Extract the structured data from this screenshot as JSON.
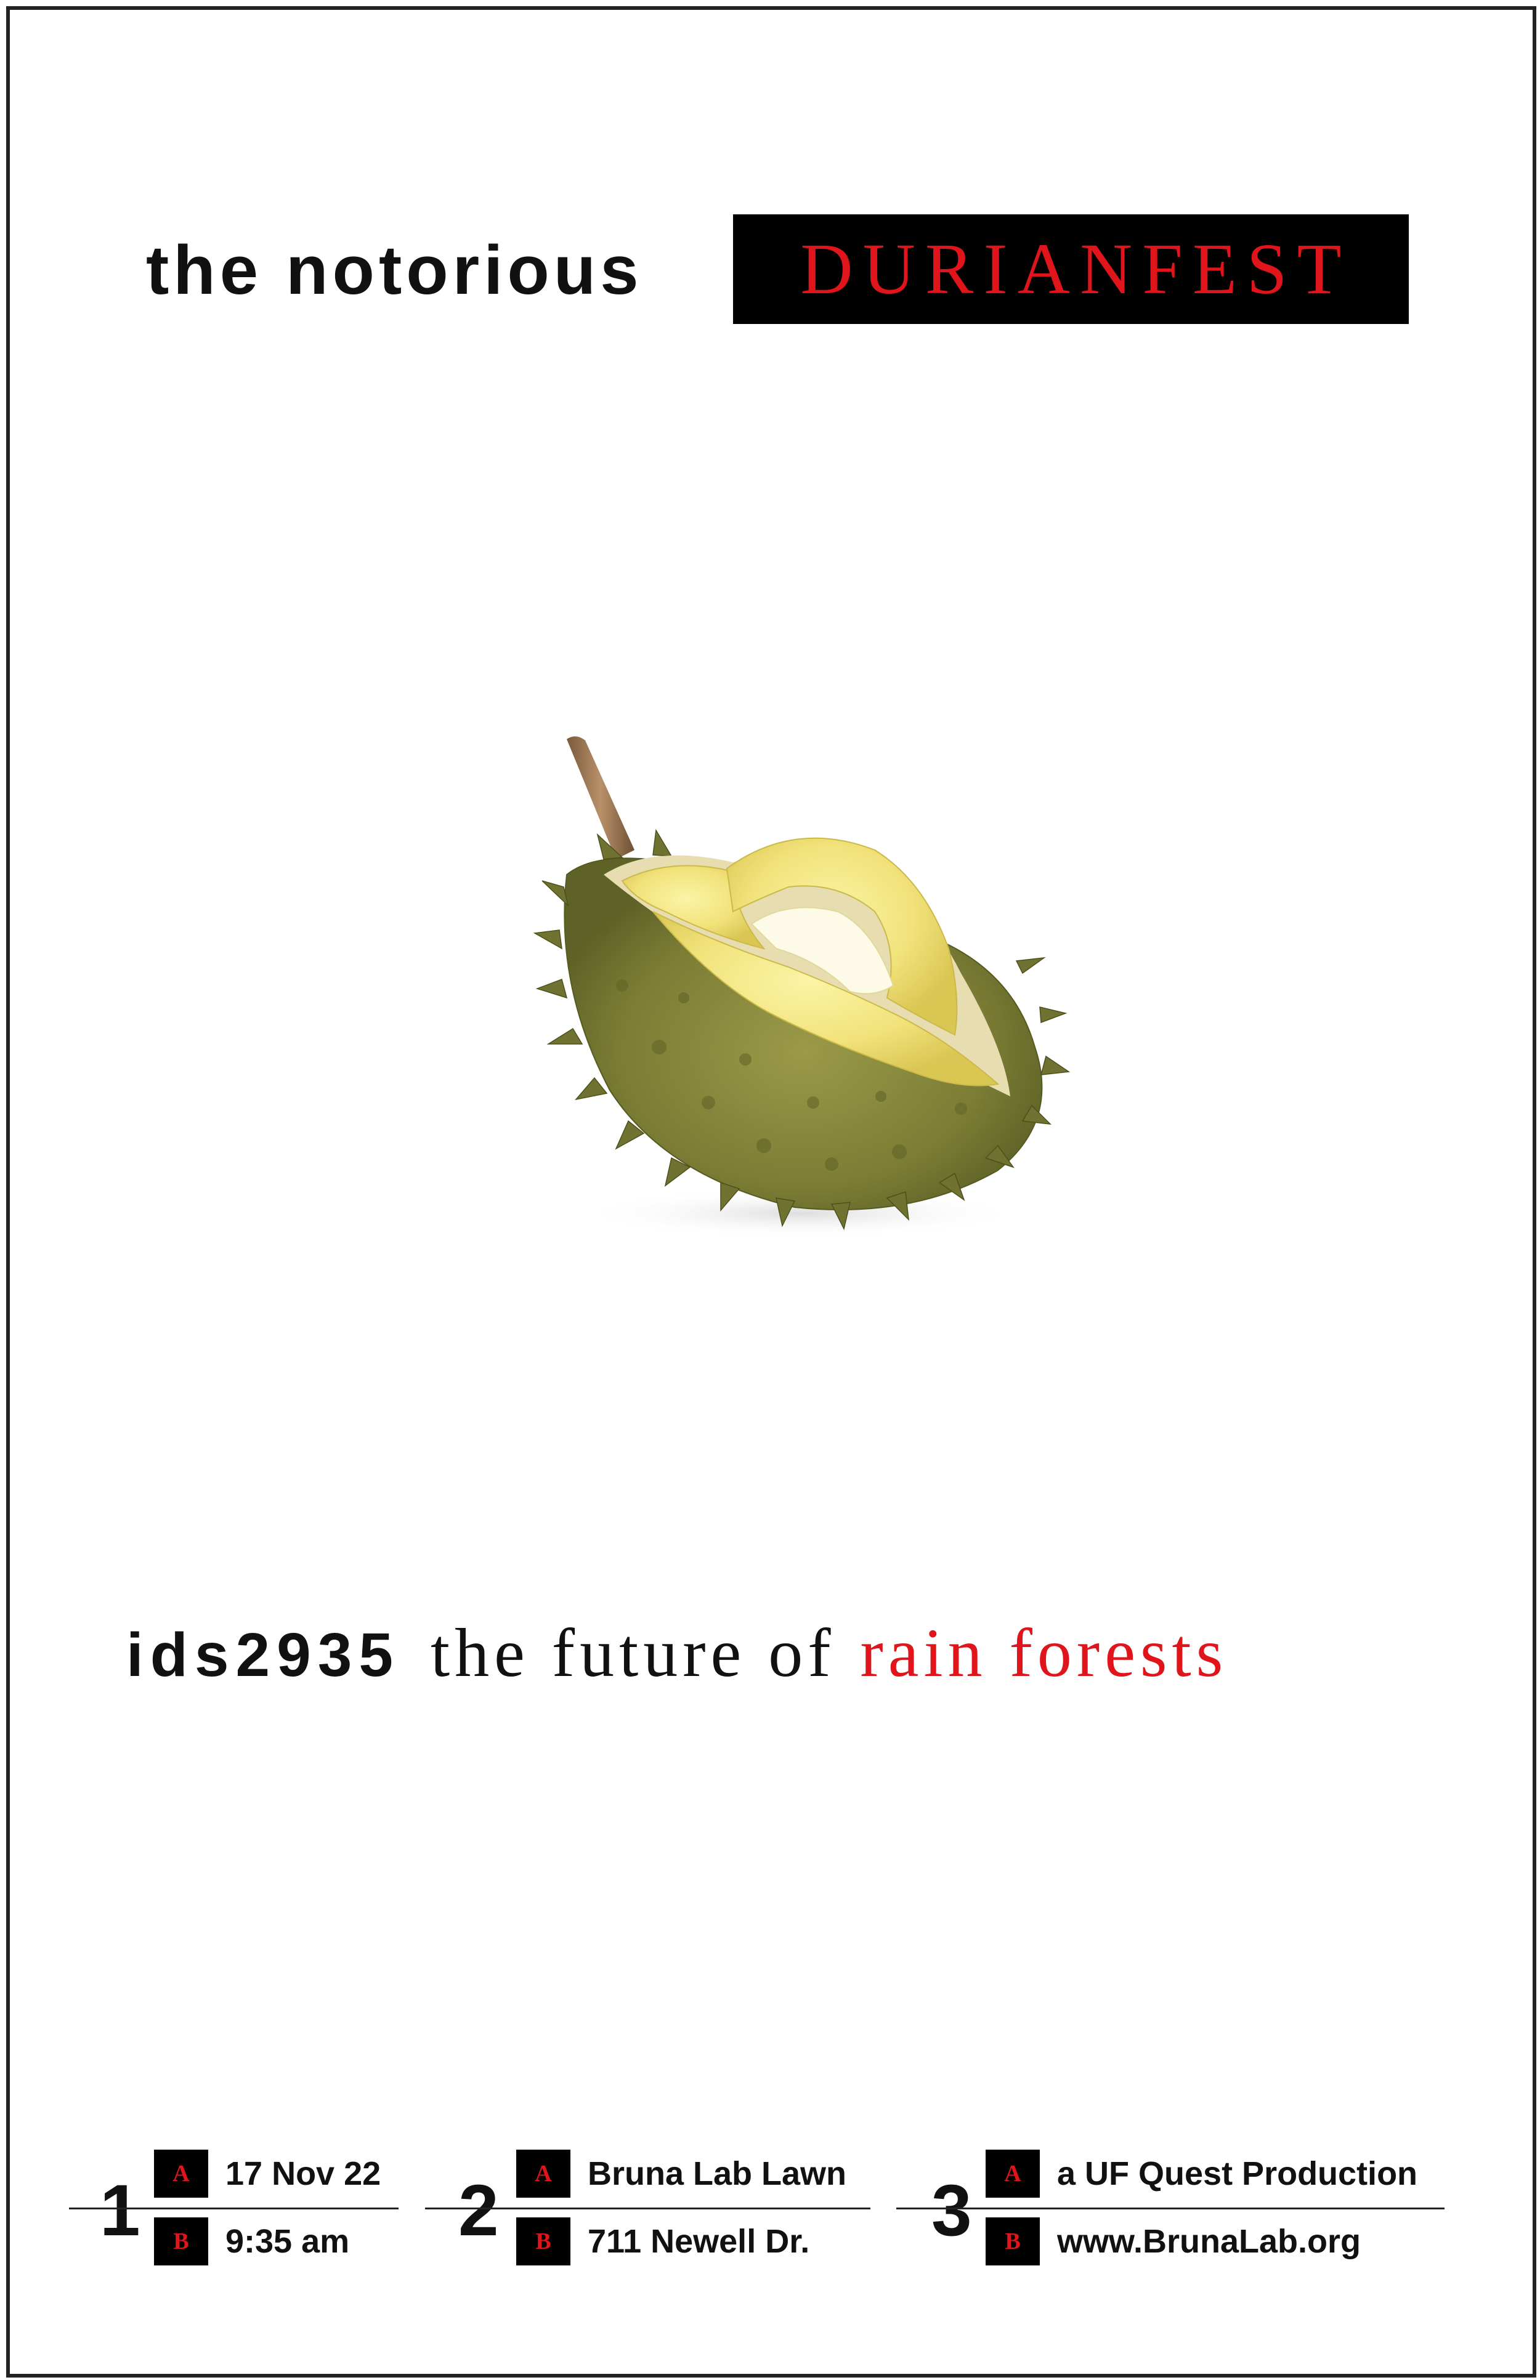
{
  "title": {
    "lead": "the notorious",
    "highlight": "DURIANFEST"
  },
  "image": {
    "subject": "opened durian fruit"
  },
  "subtitle": {
    "code": "ids2935",
    "text": "the future of",
    "accent": "rain forests"
  },
  "info": [
    {
      "number": "1",
      "a_label": "A",
      "a_text": "17 Nov 22",
      "b_label": "B",
      "b_text": "9:35 am"
    },
    {
      "number": "2",
      "a_label": "A",
      "a_text": "Bruna Lab Lawn",
      "b_label": "B",
      "b_text": "711 Newell Dr."
    },
    {
      "number": "3",
      "a_label": "A",
      "a_text": "a UF Quest Production",
      "b_label": "B",
      "b_text": "www.BrunaLab.org"
    }
  ],
  "colors": {
    "accent_red": "#e0141b",
    "text": "#111111",
    "box": "#000000"
  }
}
